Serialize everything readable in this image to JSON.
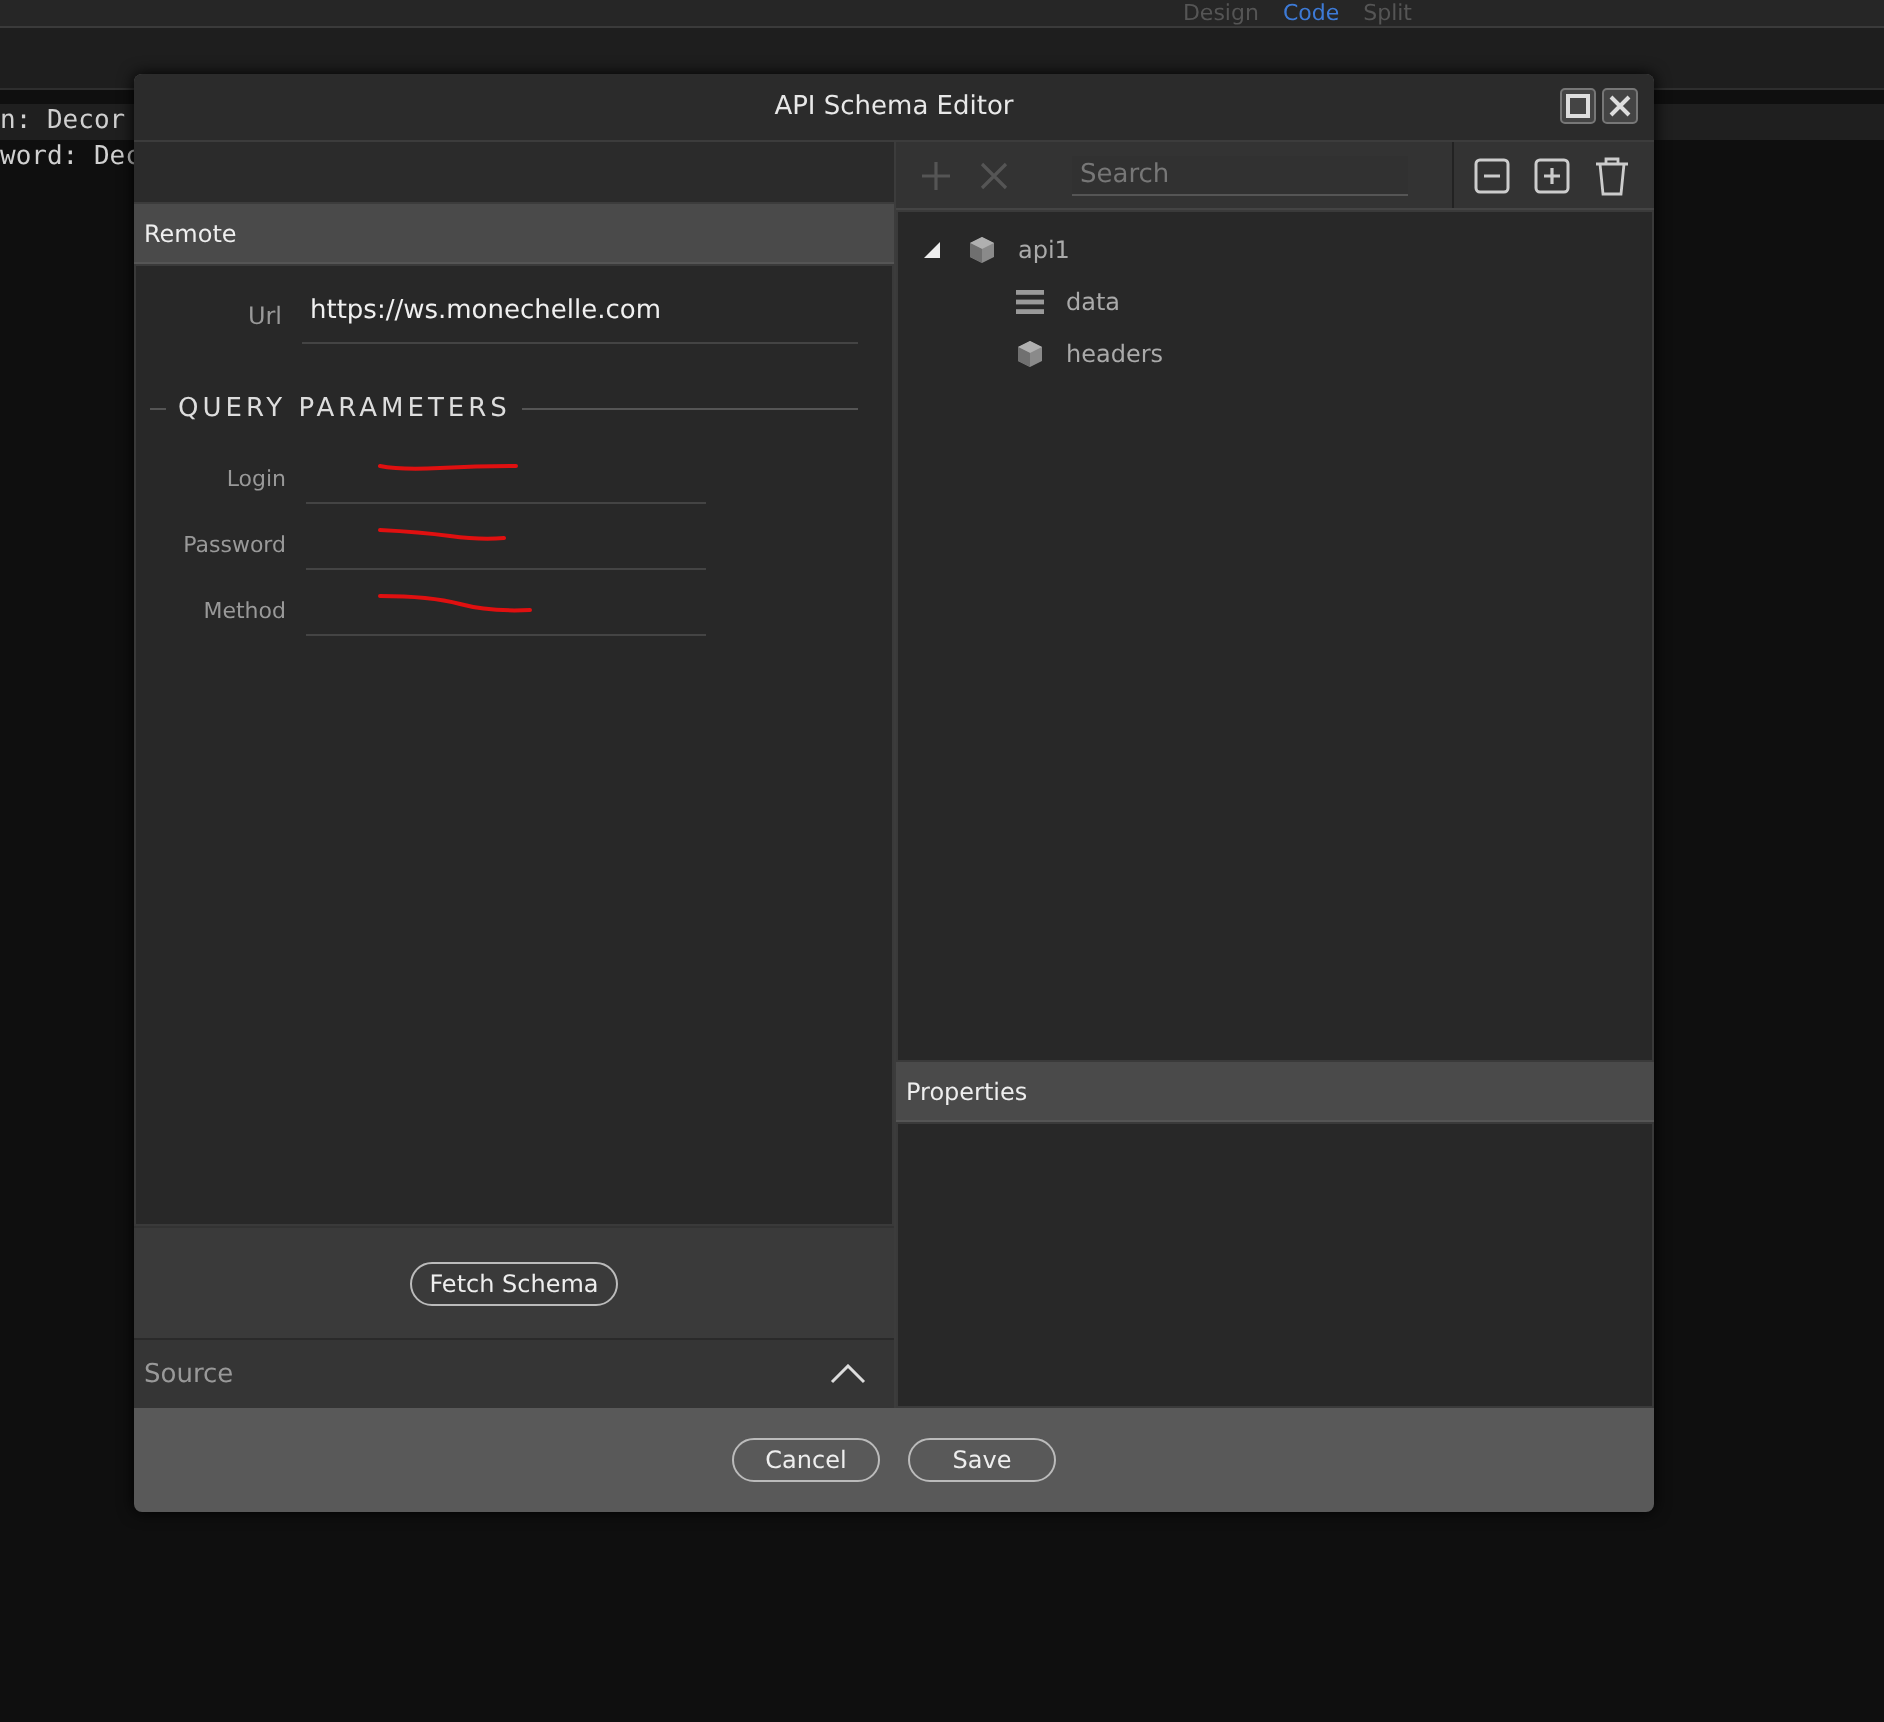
{
  "background_editor": {
    "view_tabs": [
      {
        "label": "Design",
        "selected": false
      },
      {
        "label": "Code",
        "selected": true
      },
      {
        "label": "Split",
        "selected": false
      }
    ],
    "code_lines": [
      "n: Decor",
      "word: Dec"
    ]
  },
  "dialog": {
    "title": "API Schema Editor",
    "remote": {
      "header": "Remote",
      "url_label": "Url",
      "url_value": "https://ws.monechelle.com",
      "section_title": "QUERY PARAMETERS",
      "parameters": [
        {
          "label": "Login",
          "redacted": true
        },
        {
          "label": "Password",
          "redacted": true
        },
        {
          "label": "Method",
          "redacted": true
        }
      ],
      "fetch_button": "Fetch Schema",
      "source_label": "Source",
      "source_expanded": false
    },
    "toolbar": {
      "add_disabled": true,
      "remove_disabled": true,
      "search": {
        "placeholder": "Search"
      }
    },
    "tree": [
      {
        "label": "api1",
        "kind": "object",
        "expanded": true,
        "children": [
          {
            "label": "data",
            "kind": "array"
          },
          {
            "label": "headers",
            "kind": "object"
          }
        ]
      }
    ],
    "properties_header": "Properties",
    "buttons": [
      "Cancel",
      "Save"
    ]
  }
}
